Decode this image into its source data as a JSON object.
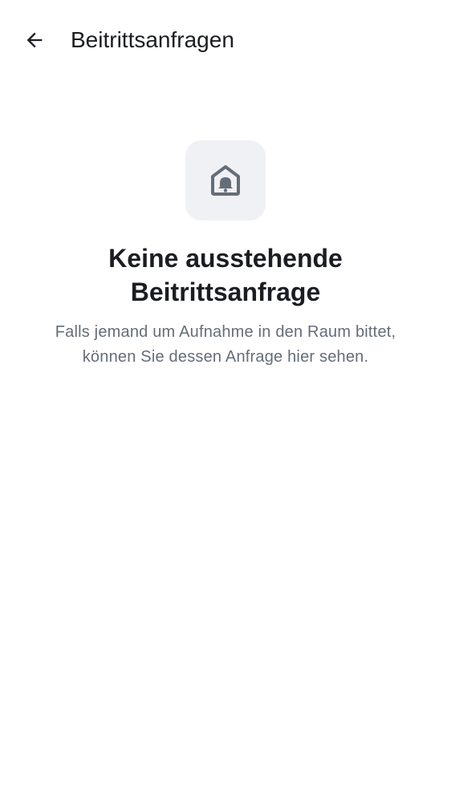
{
  "header": {
    "title": "Beitrittsanfragen",
    "back_icon": "arrow-left-icon"
  },
  "empty_state": {
    "icon": "home-bell-icon",
    "heading": "Keine ausstehende Beitrittsanfrage",
    "description": "Falls jemand um Aufnahme in den Raum bittet, können Sie dessen Anfrage hier sehen."
  },
  "colors": {
    "background": "#ffffff",
    "primary_text": "#1b1d22",
    "secondary_text": "#656d77",
    "icon_tile": "#eff1f5",
    "icon": "#656d77"
  }
}
